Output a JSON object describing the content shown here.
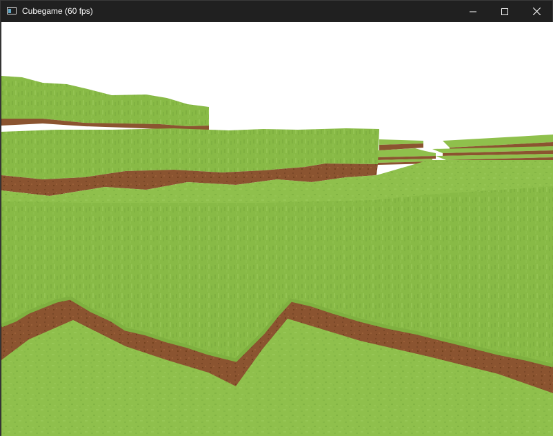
{
  "window": {
    "title": "Cubegame (60 fps)",
    "app_icon": "window-app-icon",
    "controls": {
      "minimize_icon": "minimize-icon",
      "maximize_icon": "maximize-icon",
      "close_icon": "close-icon"
    }
  },
  "scene": {
    "sky_color": "#ffffff",
    "grass_color": "#8fc04c",
    "grass_dark_color": "#7fae41",
    "dirt_color": "#8b5430",
    "dirt_dark_color": "#6e4224"
  }
}
